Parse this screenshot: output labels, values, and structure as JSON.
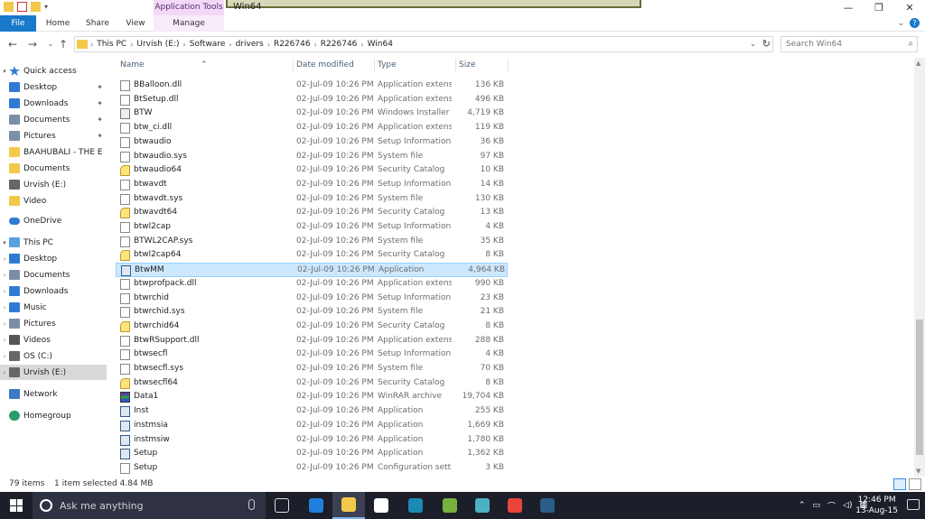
{
  "window": {
    "context_tab": "Application Tools",
    "title": "Win64",
    "controls": [
      "—",
      "❐",
      "✕"
    ]
  },
  "ribbon": {
    "tabs": [
      "File",
      "Home",
      "Share",
      "View",
      "Manage"
    ]
  },
  "address": {
    "crumbs": [
      "This PC",
      "Urvish (E:)",
      "Software",
      "drivers",
      "R226746",
      "R226746",
      "Win64"
    ],
    "search_placeholder": "Search Win64"
  },
  "nav": {
    "quick_access": "Quick access",
    "items": [
      {
        "label": "Desktop",
        "pinned": true,
        "icon": "desktop-icon",
        "color": "#2f7bd3"
      },
      {
        "label": "Downloads",
        "pinned": true,
        "icon": "downloads-icon",
        "color": "#2f7bd3"
      },
      {
        "label": "Documents",
        "pinned": true,
        "icon": "documents-icon",
        "color": "#7a8ea8"
      },
      {
        "label": "Pictures",
        "pinned": true,
        "icon": "pictures-icon",
        "color": "#7a8ea8"
      },
      {
        "label": "BAAHUBALI - THE E",
        "pinned": false,
        "icon": "folder-icon",
        "color": "#f3c94a"
      },
      {
        "label": "Documents",
        "pinned": false,
        "icon": "folder-icon",
        "color": "#f3c94a"
      },
      {
        "label": "Urvish (E:)",
        "pinned": false,
        "icon": "drive-icon",
        "color": "#666"
      },
      {
        "label": "Video",
        "pinned": false,
        "icon": "folder-icon",
        "color": "#f3c94a"
      }
    ],
    "onedrive": "OneDrive",
    "this_pc": "This PC",
    "pc_items": [
      {
        "label": "Desktop",
        "icon": "desktop-icon",
        "color": "#2f7bd3"
      },
      {
        "label": "Documents",
        "icon": "documents-icon",
        "color": "#7a8ea8"
      },
      {
        "label": "Downloads",
        "icon": "downloads-icon",
        "color": "#2f7bd3"
      },
      {
        "label": "Music",
        "icon": "music-icon",
        "color": "#2f7bd3"
      },
      {
        "label": "Pictures",
        "icon": "pictures-icon",
        "color": "#7a8ea8"
      },
      {
        "label": "Videos",
        "icon": "videos-icon",
        "color": "#555"
      },
      {
        "label": "OS (C:)",
        "icon": "drive-icon",
        "color": "#666"
      },
      {
        "label": "Urvish (E:)",
        "icon": "drive-icon",
        "color": "#666",
        "selected": true
      }
    ],
    "network": "Network",
    "homegroup": "Homegroup"
  },
  "columns": {
    "name": "Name",
    "date": "Date modified",
    "type": "Type",
    "size": "Size"
  },
  "files": [
    {
      "name": "BBalloon.dll",
      "date": "02-Jul-09 10:26 PM",
      "type": "Application extens...",
      "size": "136 KB",
      "kind": "doc"
    },
    {
      "name": "BtSetup.dll",
      "date": "02-Jul-09 10:26 PM",
      "type": "Application extens...",
      "size": "496 KB",
      "kind": "doc"
    },
    {
      "name": "BTW",
      "date": "02-Jul-09 10:26 PM",
      "type": "Windows Installer ...",
      "size": "4,719 KB",
      "kind": "msi"
    },
    {
      "name": "btw_ci.dll",
      "date": "02-Jul-09 10:26 PM",
      "type": "Application extens...",
      "size": "119 KB",
      "kind": "doc"
    },
    {
      "name": "btwaudio",
      "date": "02-Jul-09 10:26 PM",
      "type": "Setup Information",
      "size": "36 KB",
      "kind": "doc"
    },
    {
      "name": "btwaudio.sys",
      "date": "02-Jul-09 10:26 PM",
      "type": "System file",
      "size": "97 KB",
      "kind": "doc"
    },
    {
      "name": "btwaudio64",
      "date": "02-Jul-09 10:26 PM",
      "type": "Security Catalog",
      "size": "10 KB",
      "kind": "cat"
    },
    {
      "name": "btwavdt",
      "date": "02-Jul-09 10:26 PM",
      "type": "Setup Information",
      "size": "14 KB",
      "kind": "doc"
    },
    {
      "name": "btwavdt.sys",
      "date": "02-Jul-09 10:26 PM",
      "type": "System file",
      "size": "130 KB",
      "kind": "doc"
    },
    {
      "name": "btwavdt64",
      "date": "02-Jul-09 10:26 PM",
      "type": "Security Catalog",
      "size": "13 KB",
      "kind": "cat"
    },
    {
      "name": "btwl2cap",
      "date": "02-Jul-09 10:26 PM",
      "type": "Setup Information",
      "size": "4 KB",
      "kind": "doc"
    },
    {
      "name": "BTWL2CAP.sys",
      "date": "02-Jul-09 10:26 PM",
      "type": "System file",
      "size": "35 KB",
      "kind": "doc"
    },
    {
      "name": "btwl2cap64",
      "date": "02-Jul-09 10:26 PM",
      "type": "Security Catalog",
      "size": "8 KB",
      "kind": "cat"
    },
    {
      "name": "BtwMM",
      "date": "02-Jul-09 10:26 PM",
      "type": "Application",
      "size": "4,964 KB",
      "kind": "app",
      "selected": true
    },
    {
      "name": "btwprofpack.dll",
      "date": "02-Jul-09 10:26 PM",
      "type": "Application extens...",
      "size": "990 KB",
      "kind": "doc"
    },
    {
      "name": "btwrchid",
      "date": "02-Jul-09 10:26 PM",
      "type": "Setup Information",
      "size": "23 KB",
      "kind": "doc"
    },
    {
      "name": "btwrchid.sys",
      "date": "02-Jul-09 10:26 PM",
      "type": "System file",
      "size": "21 KB",
      "kind": "doc"
    },
    {
      "name": "btwrchid64",
      "date": "02-Jul-09 10:26 PM",
      "type": "Security Catalog",
      "size": "8 KB",
      "kind": "cat"
    },
    {
      "name": "BtwRSupport.dll",
      "date": "02-Jul-09 10:26 PM",
      "type": "Application extens...",
      "size": "288 KB",
      "kind": "doc"
    },
    {
      "name": "btwsecfl",
      "date": "02-Jul-09 10:26 PM",
      "type": "Setup Information",
      "size": "4 KB",
      "kind": "doc"
    },
    {
      "name": "btwsecfl.sys",
      "date": "02-Jul-09 10:26 PM",
      "type": "System file",
      "size": "70 KB",
      "kind": "doc"
    },
    {
      "name": "btwsecfl64",
      "date": "02-Jul-09 10:26 PM",
      "type": "Security Catalog",
      "size": "8 KB",
      "kind": "cat"
    },
    {
      "name": "Data1",
      "date": "02-Jul-09 10:26 PM",
      "type": "WinRAR archive",
      "size": "19,704 KB",
      "kind": "rar"
    },
    {
      "name": "Inst",
      "date": "02-Jul-09 10:26 PM",
      "type": "Application",
      "size": "255 KB",
      "kind": "app"
    },
    {
      "name": "instmsia",
      "date": "02-Jul-09 10:26 PM",
      "type": "Application",
      "size": "1,669 KB",
      "kind": "app"
    },
    {
      "name": "instmsiw",
      "date": "02-Jul-09 10:26 PM",
      "type": "Application",
      "size": "1,780 KB",
      "kind": "app"
    },
    {
      "name": "Setup",
      "date": "02-Jul-09 10:26 PM",
      "type": "Application",
      "size": "1,362 KB",
      "kind": "app"
    },
    {
      "name": "Setup",
      "date": "02-Jul-09 10:26 PM",
      "type": "Configuration sett...",
      "size": "3 KB",
      "kind": "doc"
    }
  ],
  "status": {
    "count": "79 items",
    "selection": "1 item selected  4.84 MB"
  },
  "taskbar": {
    "search_placeholder": "Ask me anything",
    "time": "12:46 PM",
    "date": "13-Aug-15",
    "apps": [
      {
        "name": "task-view-icon",
        "color": "#1c1e2a"
      },
      {
        "name": "edge-icon",
        "color": "#1f7fdc"
      },
      {
        "name": "file-explorer-icon",
        "color": "#f3c94a",
        "active": true
      },
      {
        "name": "store-icon",
        "color": "#ffffff"
      },
      {
        "name": "app-icon",
        "color": "#1b8ab5"
      },
      {
        "name": "utorrent-icon",
        "color": "#77b23d"
      },
      {
        "name": "media-player-icon",
        "color": "#4bb2c4"
      },
      {
        "name": "chrome-icon",
        "color": "#e8453c"
      },
      {
        "name": "steam-icon",
        "color": "#2a5d8a"
      }
    ]
  }
}
